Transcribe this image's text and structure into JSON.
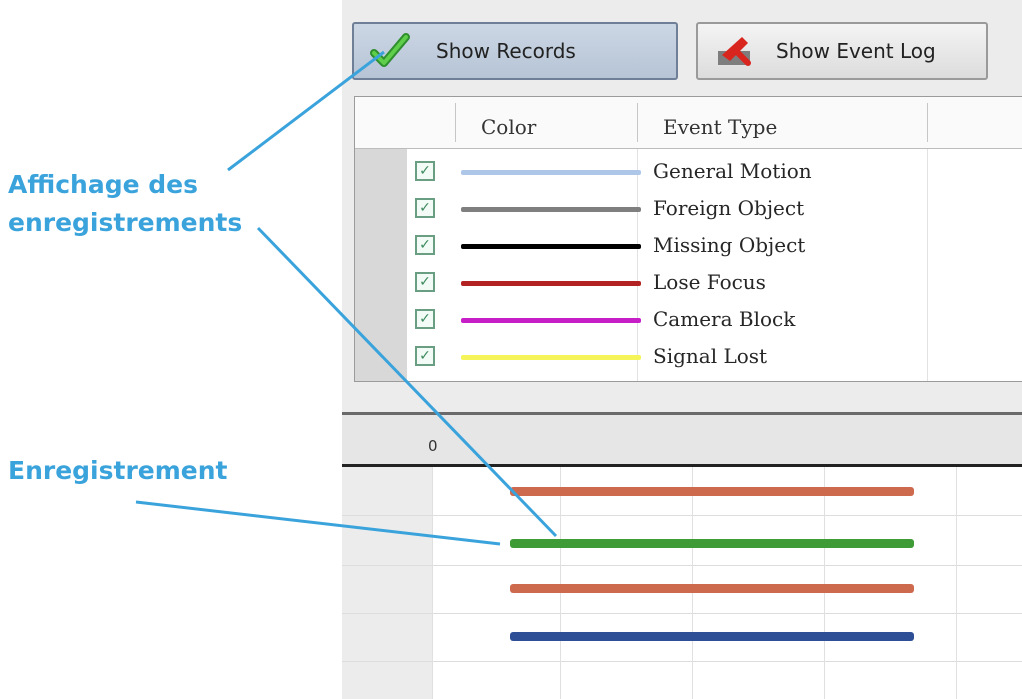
{
  "toolbar": {
    "show_records_label": "Show Records",
    "show_event_log_label": "Show Event Log"
  },
  "legend": {
    "columns": [
      "Color",
      "Event Type"
    ],
    "rows": [
      {
        "event": "General Motion",
        "color": "#aec7e8",
        "checked": true
      },
      {
        "event": "Foreign Object",
        "color": "#7f7f7f",
        "checked": true
      },
      {
        "event": "Missing Object",
        "color": "#000000",
        "checked": true
      },
      {
        "event": "Lose Focus",
        "color": "#b22222",
        "checked": true
      },
      {
        "event": "Camera Block",
        "color": "#c71fc7",
        "checked": true
      },
      {
        "event": "Signal Lost",
        "color": "#f5f55a",
        "checked": true
      }
    ]
  },
  "timeline": {
    "tick_label": "0",
    "records": [
      {
        "color": "#cd6a4e"
      },
      {
        "color": "#3f9b35"
      },
      {
        "color": "#cd6a4e"
      },
      {
        "color": "#2e4f96"
      }
    ]
  },
  "annotations": {
    "records_display_line1": "Affichage des",
    "records_display_line2": "enregistrements",
    "record": "Enregistrement",
    "color": "#3aa3dc"
  },
  "icons": {
    "show_records": "green-check-icon",
    "show_event_log": "red-event-icon"
  }
}
